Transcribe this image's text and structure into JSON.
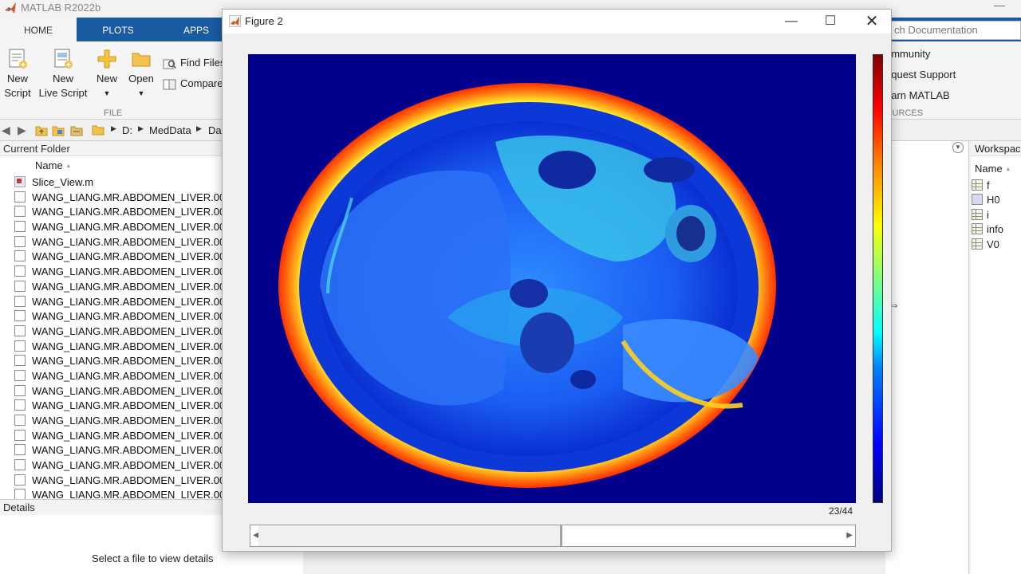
{
  "app": {
    "title": "MATLAB R2022b"
  },
  "ribbon": {
    "tabs": [
      {
        "label": "HOME",
        "active": true
      },
      {
        "label": "PLOTS",
        "active": false
      },
      {
        "label": "APPS",
        "active": false
      }
    ],
    "file_group": {
      "label": "FILE",
      "new_script": [
        "New",
        "Script"
      ],
      "new_live_script": [
        "New",
        "Live Script"
      ],
      "new": "New",
      "open": "Open",
      "find_files": "Find Files",
      "compare": "Compare"
    },
    "resources": {
      "search_placeholder": "ch Documentation",
      "community": "ommunity",
      "request_support": "equest Support",
      "learn_matlab": "earn MATLAB",
      "group_label": "OURCES"
    }
  },
  "address": {
    "path": [
      "D:",
      "MedData",
      "Da"
    ]
  },
  "current_folder": {
    "title": "Current Folder",
    "name_col": "Name",
    "sort_indicator": "▲",
    "files": [
      {
        "name": "Slice_View.m",
        "type": "mfile"
      },
      {
        "name": "WANG_LIANG.MR.ABDOMEN_LIVER.0024",
        "type": "file"
      },
      {
        "name": "WANG_LIANG.MR.ABDOMEN_LIVER.0024",
        "type": "file"
      },
      {
        "name": "WANG_LIANG.MR.ABDOMEN_LIVER.0024",
        "type": "file"
      },
      {
        "name": "WANG_LIANG.MR.ABDOMEN_LIVER.0024",
        "type": "file"
      },
      {
        "name": "WANG_LIANG.MR.ABDOMEN_LIVER.0024",
        "type": "file"
      },
      {
        "name": "WANG_LIANG.MR.ABDOMEN_LIVER.0024",
        "type": "file"
      },
      {
        "name": "WANG_LIANG.MR.ABDOMEN_LIVER.0024",
        "type": "file"
      },
      {
        "name": "WANG_LIANG.MR.ABDOMEN_LIVER.0024",
        "type": "file"
      },
      {
        "name": "WANG_LIANG.MR.ABDOMEN_LIVER.0024",
        "type": "file"
      },
      {
        "name": "WANG_LIANG.MR.ABDOMEN_LIVER.0024",
        "type": "file"
      },
      {
        "name": "WANG_LIANG.MR.ABDOMEN_LIVER.0024",
        "type": "file"
      },
      {
        "name": "WANG_LIANG.MR.ABDOMEN_LIVER.0024",
        "type": "file"
      },
      {
        "name": "WANG_LIANG.MR.ABDOMEN_LIVER.0024",
        "type": "file"
      },
      {
        "name": "WANG_LIANG.MR.ABDOMEN_LIVER.0024",
        "type": "file"
      },
      {
        "name": "WANG_LIANG.MR.ABDOMEN_LIVER.0024",
        "type": "file"
      },
      {
        "name": "WANG_LIANG.MR.ABDOMEN_LIVER.0024",
        "type": "file"
      },
      {
        "name": "WANG_LIANG.MR.ABDOMEN_LIVER.0024",
        "type": "file"
      },
      {
        "name": "WANG_LIANG.MR.ABDOMEN_LIVER.0024",
        "type": "file"
      },
      {
        "name": "WANG_LIANG.MR.ABDOMEN_LIVER.0024",
        "type": "file"
      },
      {
        "name": "WANG_LIANG.MR.ABDOMEN_LIVER.0024",
        "type": "file"
      },
      {
        "name": "WANG_LIANG.MR.ABDOMEN_LIVER.0024",
        "type": "file"
      },
      {
        "name": "WANG_LIANG.MR.ABDOMEN_LIVER.0024",
        "type": "file"
      }
    ]
  },
  "details": {
    "title": "Details",
    "empty_text": "Select a file to view details"
  },
  "workspace": {
    "title": "Workspace",
    "name_col": "Name",
    "sort_indicator": "▲",
    "variables": [
      {
        "name": "f",
        "icon": "matrix-icon"
      },
      {
        "name": "H0",
        "icon": "object-icon"
      },
      {
        "name": "i",
        "icon": "matrix-icon"
      },
      {
        "name": "info",
        "icon": "matrix-icon"
      },
      {
        "name": "V0",
        "icon": "matrix-icon"
      }
    ]
  },
  "figure": {
    "title": "Figure 2",
    "slice_label": "23/44",
    "slider_value": 23,
    "slider_max": 44,
    "colormap": "jet",
    "image_content": "axial abdominal MRI slice, jet colormap"
  },
  "colors": {
    "ribbon_tab_bg": "#1a5aa0",
    "axes_bg": "#00008c",
    "image_dark_blue": "#00008c",
    "accent_folder": "#f2c14e"
  }
}
